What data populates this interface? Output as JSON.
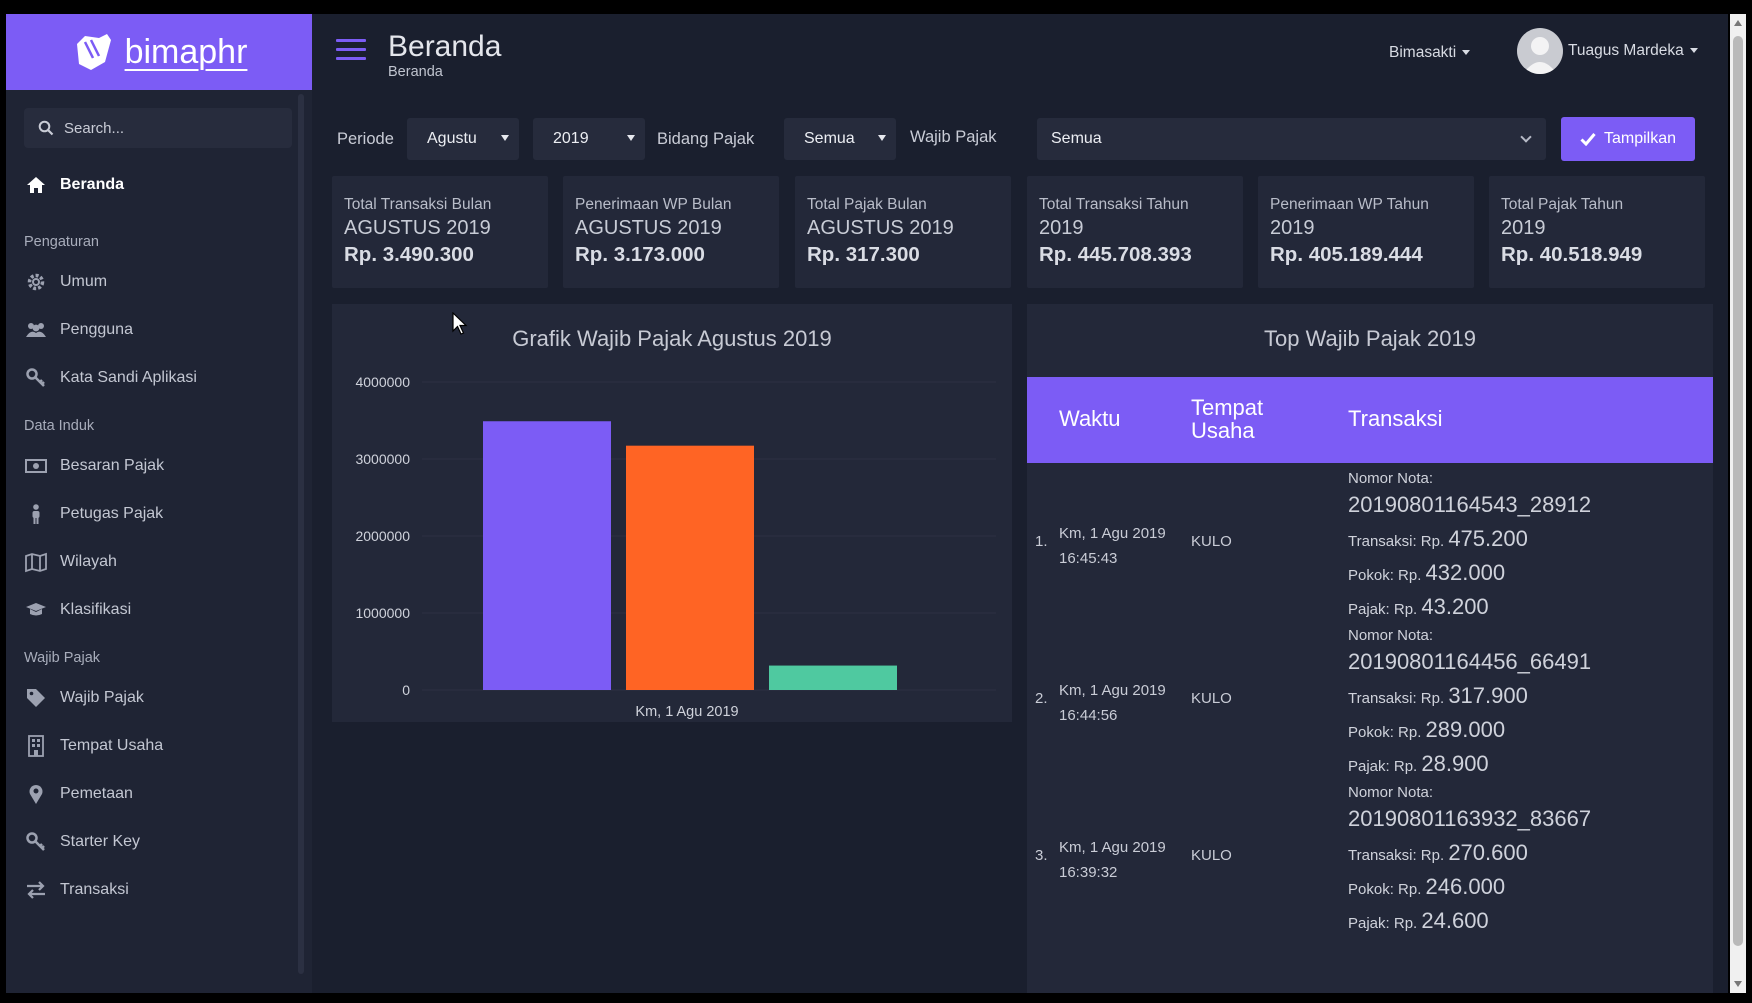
{
  "brand": {
    "name": "bimaphr"
  },
  "sidebar": {
    "search_placeholder": "Search...",
    "active": {
      "label": "Beranda",
      "icon": "home-icon"
    },
    "sections": [
      {
        "heading": "Pengaturan",
        "items": [
          {
            "label": "Umum",
            "icon": "gear-icon"
          },
          {
            "label": "Pengguna",
            "icon": "users-icon"
          },
          {
            "label": "Kata Sandi Aplikasi",
            "icon": "key-icon"
          }
        ]
      },
      {
        "heading": "Data Induk",
        "items": [
          {
            "label": "Besaran Pajak",
            "icon": "money-icon"
          },
          {
            "label": "Petugas Pajak",
            "icon": "person-icon"
          },
          {
            "label": "Wilayah",
            "icon": "map-icon"
          },
          {
            "label": "Klasifikasi",
            "icon": "graduation-cap-icon"
          }
        ]
      },
      {
        "heading": "Wajib Pajak",
        "items": [
          {
            "label": "Wajib Pajak",
            "icon": "tag-icon"
          },
          {
            "label": "Tempat Usaha",
            "icon": "building-icon"
          },
          {
            "label": "Pemetaan",
            "icon": "map-marker-icon"
          },
          {
            "label": "Starter Key",
            "icon": "key-icon"
          },
          {
            "label": "Transaksi",
            "icon": "exchange-icon"
          }
        ]
      }
    ]
  },
  "header": {
    "title": "Beranda",
    "breadcrumb": "Beranda",
    "org": "Bimasakti",
    "user": "Tuagus Mardeka"
  },
  "filters": {
    "periode_label": "Periode",
    "month": "Agustu",
    "year": "2019",
    "bidang_label": "Bidang Pajak",
    "bidang": "Semua",
    "wajib_label": "Wajib Pajak",
    "wajib": "Semua",
    "submit": "Tampilkan"
  },
  "stats": [
    {
      "line1": "Total Transaksi Bulan",
      "line2": "AGUSTUS 2019",
      "value": "Rp. 3.490.300"
    },
    {
      "line1": "Penerimaan WP Bulan",
      "line2": "AGUSTUS 2019",
      "value": "Rp. 3.173.000"
    },
    {
      "line1": "Total Pajak Bulan",
      "line2": "AGUSTUS 2019",
      "value": "Rp. 317.300"
    },
    {
      "line1": "Total Transaksi Tahun",
      "line2": "2019",
      "value": "Rp. 445.708.393"
    },
    {
      "line1": "Penerimaan WP Tahun",
      "line2": "2019",
      "value": "Rp. 405.189.444"
    },
    {
      "line1": "Total Pajak Tahun",
      "line2": "2019",
      "value": "Rp. 40.518.949"
    }
  ],
  "chart_data": {
    "type": "bar",
    "title": "Grafik Wajib Pajak Agustus 2019",
    "categories": [
      "Km, 1 Agu 2019"
    ],
    "series": [
      {
        "values": [
          3490300
        ],
        "color": "#7c5cf5"
      },
      {
        "values": [
          3173000
        ],
        "color": "#ff6424"
      },
      {
        "values": [
          317300
        ],
        "color": "#4fc9a0"
      }
    ],
    "ylim": [
      0,
      4000000
    ],
    "yticks": [
      "0",
      "1000000",
      "2000000",
      "3000000",
      "4000000"
    ],
    "grid": true
  },
  "top": {
    "title": "Top Wajib Pajak 2019",
    "columns": [
      "Waktu",
      "Tempat\nUsaha",
      "Transaksi"
    ],
    "labels": {
      "nota": "Nomor Nota:",
      "transaksi": "Transaksi: Rp.",
      "pokok": "Pokok: Rp.",
      "pajak": "Pajak: Rp."
    },
    "rows": [
      {
        "no": "1.",
        "date": "Km, 1 Agu 2019",
        "time": "16:45:43",
        "place": "KULO",
        "nota": "20190801164543_28912",
        "transaksi": "475.200",
        "pokok": "432.000",
        "pajak": "43.200"
      },
      {
        "no": "2.",
        "date": "Km, 1 Agu 2019",
        "time": "16:44:56",
        "place": "KULO",
        "nota": "20190801164456_66491",
        "transaksi": "317.900",
        "pokok": "289.000",
        "pajak": "28.900"
      },
      {
        "no": "3.",
        "date": "Km, 1 Agu 2019",
        "time": "16:39:32",
        "place": "KULO",
        "nota": "20190801163932_83667",
        "transaksi": "270.600",
        "pokok": "246.000",
        "pajak": "24.600"
      }
    ]
  },
  "colors": {
    "accent": "#7c5cf5",
    "background": "#1a1f2e",
    "panel": "#232839",
    "sidebar": "#1f2434"
  }
}
